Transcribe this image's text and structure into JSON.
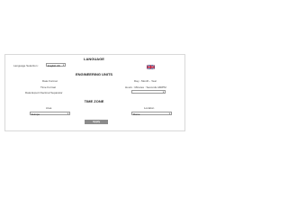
{
  "language": {
    "heading": "LANGUAGE",
    "selection_label": "Language Selection :",
    "selection_value": "English UK",
    "flag_icon": "uk-flag-icon"
  },
  "engineering": {
    "heading": "ENGINEERING UNITS",
    "date_format_label": "Date Format",
    "date_format_value": "Day - Month - Year",
    "time_format_label": "Time Format",
    "time_format_value": "Hours : Minutes : Seconds AM/PM",
    "separator_label": "Data Export Decimal Separator",
    "separator_value": "."
  },
  "timezone": {
    "heading": "TIME ZONE",
    "area_label": "Area",
    "area_value": "Europe",
    "location_label": "Location",
    "location_value": "Rome"
  },
  "apply_label": "Apply",
  "colors": {
    "button": "#8c8c8c",
    "border": "#d9d9d9"
  }
}
